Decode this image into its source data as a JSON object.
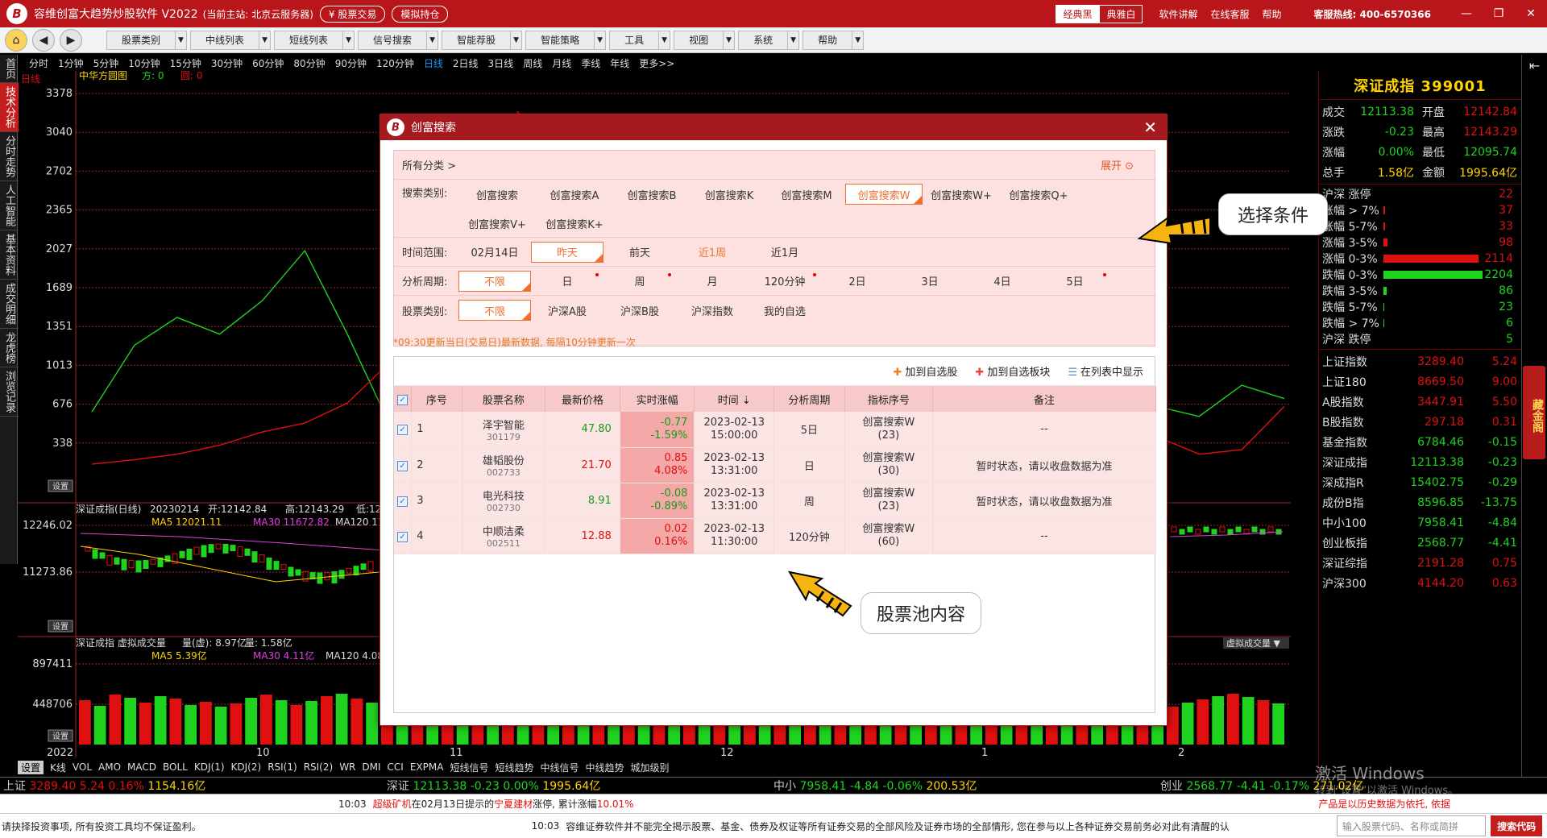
{
  "titlebar": {
    "logo": "B",
    "title": "容维创富大趋势炒股软件 V2022",
    "server": "(当前主站: 北京云服务器)",
    "btn_trade": "¥ 股票交易",
    "btn_sim": "模拟持仓",
    "skin_classic": "经典黑",
    "skin_elegant": "典雅白",
    "links": [
      "软件讲解",
      "在线客服",
      "帮助"
    ],
    "hotline": "客服热线: 400-6570366",
    "min": "—",
    "max": "❐",
    "close": "✕"
  },
  "toolbar": {
    "home": "⌂",
    "back": "◀",
    "fwd": "▶",
    "menus": [
      "股票类别",
      "中线列表",
      "短线列表",
      "信号搜索",
      "智能荐股",
      "智能策略",
      "工具",
      "视图",
      "系统",
      "帮助"
    ]
  },
  "periods": [
    "分时",
    "1分钟",
    "5分钟",
    "10分钟",
    "15分钟",
    "30分钟",
    "60分钟",
    "80分钟",
    "90分钟",
    "120分钟",
    "日线",
    "2日线",
    "3日线",
    "周线",
    "月线",
    "季线",
    "年线",
    "更多>>"
  ],
  "period_active": "日线",
  "leftnav": [
    "首页",
    "技术分析",
    "分时走势",
    "人工智能",
    "基本资料",
    "成交明细",
    "龙虎榜",
    "浏览记录"
  ],
  "chart": {
    "tag_daily": "日线",
    "ind_name": "中华方圆图",
    "ind_a": "方: 0",
    "ind_b": "圆: 0",
    "yticks1": [
      "3378",
      "3040",
      "2702",
      "2365",
      "2027",
      "1689",
      "1351",
      "1013",
      "676",
      "338"
    ],
    "kline_title": "深证成指(日线)",
    "kline_date": "20230214",
    "kline_open": "开:12142.84",
    "kline_high": "高:12143.29",
    "kline_low": "低:12095.74",
    "ma5": "MA5 12021.11",
    "ma30": "MA30 11672.82",
    "ma120": "MA120 11391.34",
    "yticks2": [
      "12246.02",
      "11273.86"
    ],
    "vol_title": "深证成指 虚拟成交量",
    "vol_v1": "量(虚): 8.97亿",
    "vol_v2": "量: 1.58亿",
    "vol_ma5": "MA5 5.39亿",
    "vol_ma30": "MA30 4.11亿",
    "vol_ma120": "MA120 4.08",
    "yticks3": [
      "897411",
      "448706"
    ],
    "setbtn": "设置",
    "xlabels": [
      "2022",
      "10",
      "11",
      "12",
      "1",
      "2"
    ],
    "vol_dropdown": "虚拟成交量 ▼"
  },
  "chart_data": [
    {
      "type": "line",
      "title": "中华方圆图",
      "series": [
        {
          "name": "方",
          "values": [
            600,
            1200,
            1450,
            1300,
            1600,
            2050,
            1300,
            480,
            300,
            260,
            700,
            1650,
            1200,
            340,
            480,
            260,
            600,
            750,
            900,
            260,
            540,
            440,
            520,
            700,
            1000,
            650,
            560,
            840,
            720
          ]
        },
        {
          "name": "圆",
          "values": [
            130,
            170,
            220,
            300,
            420,
            500,
            680,
            1050,
            1800,
            2600,
            3300,
            2900,
            1650,
            580,
            210,
            160,
            220,
            340,
            1450,
            2200,
            2550,
            1700,
            560,
            150,
            140,
            380,
            220,
            260,
            650
          ]
        }
      ],
      "ylim": [
        0,
        3378
      ]
    },
    {
      "type": "bar",
      "title": "深证成指 虚拟成交量",
      "values": [
        55,
        48,
        62,
        58,
        52,
        60,
        57,
        49,
        53,
        47,
        51,
        58,
        62,
        55,
        49,
        54,
        60,
        63,
        57,
        52,
        48,
        45,
        50,
        54,
        58,
        61,
        56,
        52,
        49,
        55,
        59,
        62,
        58,
        54,
        51,
        47,
        53,
        57,
        60,
        62,
        58,
        55,
        52,
        48,
        46,
        51,
        55,
        59,
        63,
        60,
        57,
        54,
        50,
        47,
        52,
        56,
        61,
        64,
        60,
        57,
        53,
        49,
        45,
        50,
        54,
        58,
        62,
        65,
        61,
        57,
        53,
        50,
        47,
        52,
        56,
        60,
        63,
        59,
        55,
        51
      ],
      "ylim": [
        0,
        897411
      ]
    }
  ],
  "indicator_tabs": [
    "设置",
    "K线",
    "VOL",
    "AMO",
    "MACD",
    "BOLL",
    "KDJ(1)",
    "KDJ(2)",
    "RSI(1)",
    "RSI(2)",
    "WR",
    "DMI",
    "CCI",
    "EXPMA",
    "短线信号",
    "短线趋势",
    "中线信号",
    "中线趋势",
    "城加级别"
  ],
  "dialog": {
    "title": "创富搜索",
    "close": "✕",
    "breadcrumb": "所有分类 >",
    "expand": "展开 ⊙",
    "search_label": "搜索类别:",
    "search_types": [
      "创富搜索",
      "创富搜索A",
      "创富搜索B",
      "创富搜索K",
      "创富搜索M",
      "创富搜索W",
      "创富搜索W+",
      "创富搜索Q+",
      "创富搜索V+",
      "创富搜索K+"
    ],
    "search_selected": "创富搜索W",
    "time_label": "时间范围:",
    "time_opts": [
      "02月14日",
      "昨天",
      "前天",
      "近1周",
      "近1月"
    ],
    "time_selected": "昨天",
    "cycle_label": "分析周期:",
    "cycle_opts": [
      "不限",
      "日",
      "周",
      "月",
      "120分钟",
      "2日",
      "3日",
      "4日",
      "5日"
    ],
    "cycle_selected": "不限",
    "stock_label": "股票类别:",
    "stock_opts": [
      "不限",
      "沪深A股",
      "沪深B股",
      "沪深指数",
      "我的自选"
    ],
    "stock_selected": "不限",
    "note": "*09:30更新当日(交易日)最新数据, 每隔10分钟更新一次",
    "act_add_fav": "加到自选股",
    "act_add_block": "加到自选板块",
    "act_show_list": "在列表中显示",
    "columns": [
      "序号",
      "股票名称",
      "最新价格",
      "实时涨幅",
      "时间 ⇣",
      "分析周期",
      "指标序号",
      "备注"
    ],
    "rows": [
      {
        "no": "1",
        "name": "泽宇智能",
        "code": "301179",
        "price": "47.80",
        "chg": "-0.77",
        "pct": "-1.59%",
        "date": "2023-02-13",
        "time": "15:00:00",
        "cycle": "5日",
        "ind": "创富搜索W",
        "ind_no": "(23)",
        "remark": "--",
        "dir": "down"
      },
      {
        "no": "2",
        "name": "雄韬股份",
        "code": "002733",
        "price": "21.70",
        "chg": "0.85",
        "pct": "4.08%",
        "date": "2023-02-13",
        "time": "13:31:00",
        "cycle": "日",
        "ind": "创富搜索W",
        "ind_no": "(30)",
        "remark": "暂时状态，请以收盘数据为准",
        "dir": "up"
      },
      {
        "no": "3",
        "name": "电光科技",
        "code": "002730",
        "price": "8.91",
        "chg": "-0.08",
        "pct": "-0.89%",
        "date": "2023-02-13",
        "time": "13:31:00",
        "cycle": "周",
        "ind": "创富搜索W",
        "ind_no": "(23)",
        "remark": "暂时状态，请以收盘数据为准",
        "dir": "down"
      },
      {
        "no": "4",
        "name": "中顺洁柔",
        "code": "002511",
        "price": "12.88",
        "chg": "0.02",
        "pct": "0.16%",
        "date": "2023-02-13",
        "time": "11:30:00",
        "cycle": "120分钟",
        "ind": "创富搜索W",
        "ind_no": "(60)",
        "remark": "--",
        "dir": "up"
      }
    ]
  },
  "callouts": {
    "conditions": "选择条件",
    "pool": "股票池内容"
  },
  "sidepanel": {
    "title": "深证成指  399001",
    "stats": [
      [
        "成交",
        "12113.38",
        "开盘",
        "12142.84"
      ],
      [
        "涨跌",
        "-0.23",
        "最高",
        "12143.29"
      ],
      [
        "涨幅",
        "0.00%",
        "最低",
        "12095.74"
      ],
      [
        "总手",
        "1.58亿",
        "金额",
        "1995.64亿"
      ]
    ],
    "breadth": [
      {
        "l": "沪深 涨停",
        "n": "22",
        "w": 0,
        "c": "#e01010"
      },
      {
        "l": "涨幅 > 7%",
        "n": "37",
        "w": 2,
        "c": "#e01010"
      },
      {
        "l": "涨幅 5-7%",
        "n": "33",
        "w": 2,
        "c": "#e01010"
      },
      {
        "l": "涨幅 3-5%",
        "n": "98",
        "w": 5,
        "c": "#e01010"
      },
      {
        "l": "涨幅 0-3%",
        "n": "2114",
        "w": 118,
        "c": "#e01010"
      },
      {
        "l": "跌幅 0-3%",
        "n": "2204",
        "w": 123,
        "c": "#1fd31f"
      },
      {
        "l": "跌幅 3-5%",
        "n": "86",
        "w": 4,
        "c": "#1fd31f"
      },
      {
        "l": "跌幅 5-7%",
        "n": "23",
        "w": 1,
        "c": "#1fd31f"
      },
      {
        "l": "跌幅 > 7%",
        "n": "6",
        "w": 1,
        "c": "#1fd31f"
      },
      {
        "l": "沪深 跌停",
        "n": "5",
        "w": 0,
        "c": "#1fd31f"
      }
    ],
    "indices": [
      {
        "l": "上证指数",
        "p": "3289.40",
        "c": "5.24",
        "u": true
      },
      {
        "l": "上证180",
        "p": "8669.50",
        "c": "9.00",
        "u": true
      },
      {
        "l": "A股指数",
        "p": "3447.91",
        "c": "5.50",
        "u": true
      },
      {
        "l": "B股指数",
        "p": "297.18",
        "c": "0.31",
        "u": true
      },
      {
        "l": "基金指数",
        "p": "6784.46",
        "c": "-0.15",
        "u": false
      },
      {
        "l": "深证成指",
        "p": "12113.38",
        "c": "-0.23",
        "u": false
      },
      {
        "l": "深成指R",
        "p": "15402.75",
        "c": "-0.29",
        "u": false
      },
      {
        "l": "成份B指",
        "p": "8596.85",
        "c": "-13.75",
        "u": false
      },
      {
        "l": "中小100",
        "p": "7958.41",
        "c": "-4.84",
        "u": false
      },
      {
        "l": "创业板指",
        "p": "2568.77",
        "c": "-4.41",
        "u": false
      },
      {
        "l": "深证综指",
        "p": "2191.28",
        "c": "0.75",
        "u": true
      },
      {
        "l": "沪深300",
        "p": "4144.20",
        "c": "0.63",
        "u": true
      }
    ]
  },
  "farright": {
    "back": "⇤",
    "gold": "藏金阁"
  },
  "indexbar": [
    {
      "n": "上证",
      "v": "3289.40",
      "c": "5.24",
      "p": "0.16%",
      "a": "1154.16亿",
      "u": true
    },
    {
      "n": "深证",
      "v": "12113.38",
      "c": "-0.23",
      "p": "0.00%",
      "a": "1995.64亿",
      "u": false
    },
    {
      "n": "中小",
      "v": "7958.41",
      "c": "-4.84",
      "p": "-0.06%",
      "a": "200.53亿",
      "u": false
    },
    {
      "n": "创业",
      "v": "2568.77",
      "c": "-4.41",
      "p": "-0.17%",
      "a": "271.02亿",
      "u": false
    }
  ],
  "news": {
    "time": "10:03",
    "stock": "超级矿机",
    "txt1": "在02月13日提示的",
    "stock2": "宁夏建材",
    "txt2": "涨停, 累计涨幅",
    "pct": "10.01%",
    "right": "产品是以历史数据为依托, 依据"
  },
  "bottom": {
    "left": "请抉择投资事项, 所有投资工具均不保证盈利。",
    "time": "10:03",
    "disclaimer": "容维证券软件并不能完全揭示股票、基金、债券及权证等所有证券交易的全部风险及证券市场的全部情形, 您在参与以上各种证券交易前务必对此有清醒的认",
    "placeholder": "输入股票代码、名称或简拼",
    "search": "搜索代码"
  },
  "watermark": {
    "l1": "激活 Windows",
    "l2": "转到\"设置\"以激活 Windows。"
  }
}
